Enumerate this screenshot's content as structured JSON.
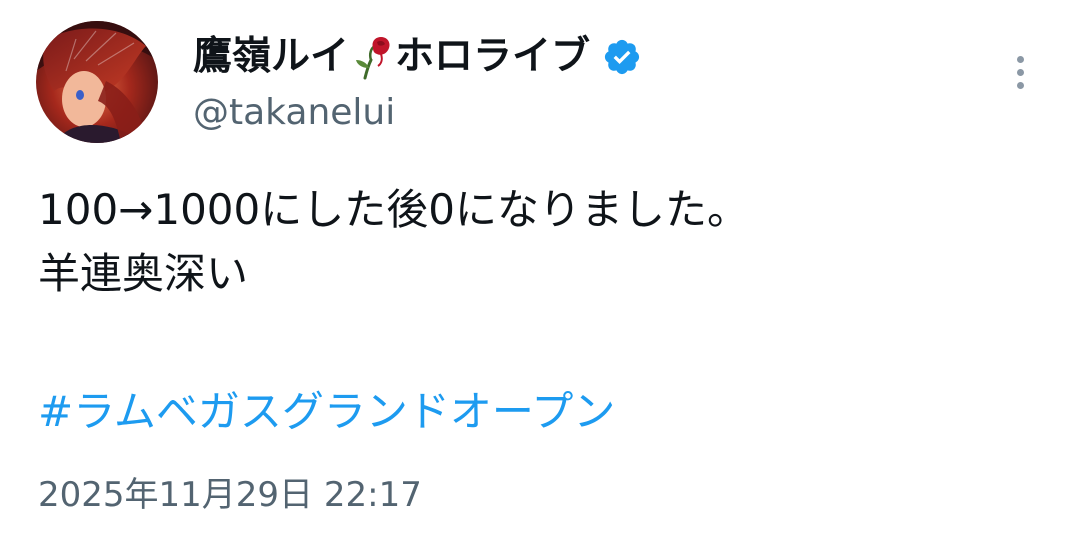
{
  "tweet": {
    "author": {
      "display_name": "鷹嶺ルイ",
      "display_name_suffix": "ホロライブ",
      "name_emoji_icon": "wilted-rose-icon",
      "verified_icon": "verified-badge-icon",
      "handle": "@takanelui"
    },
    "menu_icon": "more-vertical-icon",
    "text_lines": [
      "100→1000にした後0になりました。",
      "羊連奥深い"
    ],
    "hashtag": "#ラムベガスグランドオープン",
    "timestamp": "2025年11月29日 22:17"
  },
  "colors": {
    "text_primary": "#0f1419",
    "text_secondary": "#536471",
    "link": "#1d9bf0",
    "verified_badge": "#1d9bf0",
    "menu_dots": "#8b98a5"
  }
}
